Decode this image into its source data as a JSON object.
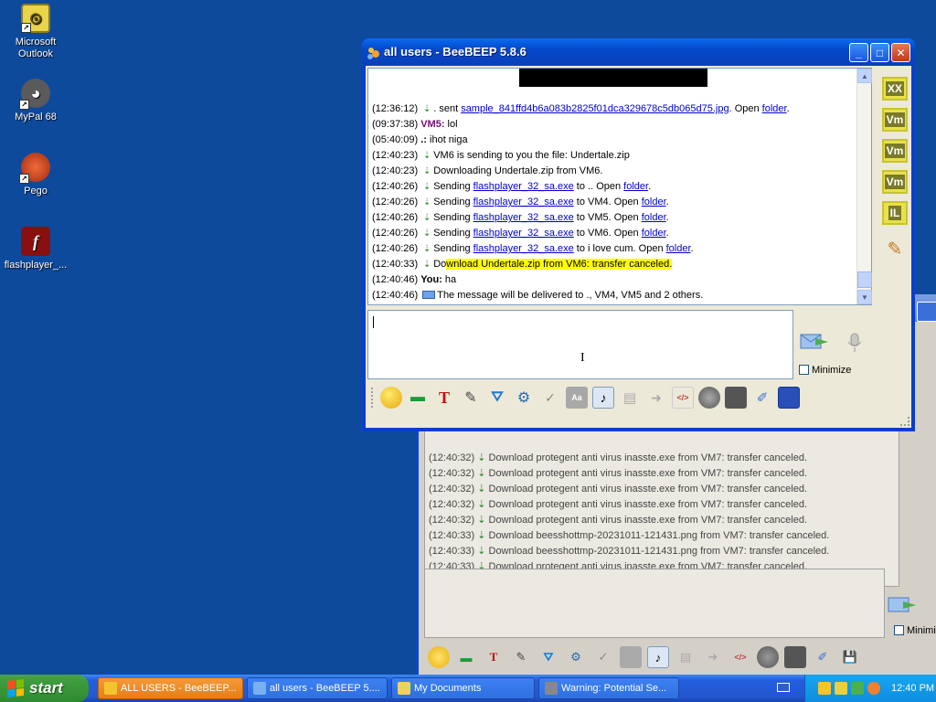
{
  "desktop": {
    "icons": [
      {
        "label": "Microsoft Outlook",
        "icon": "outlook-icon"
      },
      {
        "label": "MyPal 68",
        "icon": "mypal-icon"
      },
      {
        "label": "Pego",
        "icon": "pego-icon"
      },
      {
        "label": "flashplayer_...",
        "icon": "flash-icon"
      }
    ]
  },
  "background_window": {
    "lines": [
      {
        "ts": "(12:40:32)",
        "text": "Download protegent anti virus inasste.exe from VM7: transfer canceled."
      },
      {
        "ts": "(12:40:32)",
        "text": "Download protegent anti virus inasste.exe from VM7: transfer canceled."
      },
      {
        "ts": "(12:40:32)",
        "text": "Download protegent anti virus inasste.exe from VM7: transfer canceled."
      },
      {
        "ts": "(12:40:32)",
        "text": "Download protegent anti virus inasste.exe from VM7: transfer canceled."
      },
      {
        "ts": "(12:40:32)",
        "text": "Download protegent anti virus inasste.exe from VM7: transfer canceled."
      },
      {
        "ts": "(12:40:33)",
        "text": "Download beesshottmp-20231011-121431.png from VM7: transfer canceled."
      },
      {
        "ts": "(12:40:33)",
        "text": "Download beesshottmp-20231011-121431.png from VM7: transfer canceled."
      },
      {
        "ts": "(12:40:33)",
        "text": "Download protegent anti virus inasste.exe from VM7: transfer canceled."
      }
    ],
    "minimize_label": "Minimize"
  },
  "window": {
    "title": "all users - BeeBEEP 5.8.6",
    "minimize_label": "Minimize",
    "messages": {
      "m1": {
        "ts": "(12:36:12)",
        "pre": ". sent ",
        "link": "sample_841ffd4b6a083b2825f01dca329678c5db065d75.jpg",
        "mid": ". Open ",
        "link2": "folder",
        "post": "."
      },
      "m2": {
        "ts": "(09:37:38)",
        "user": "VM5:",
        "text": " lol"
      },
      "m3": {
        "ts": "(05:40:09)",
        "user": ".:",
        "text": " ihot niga"
      },
      "m4": {
        "ts": "(12:40:23)",
        "text": "VM6 is sending to you the file: Undertale.zip"
      },
      "m5": {
        "ts": "(12:40:23)",
        "text": "Downloading Undertale.zip from VM6."
      },
      "m6": {
        "ts": "(12:40:26)",
        "pre": "Sending ",
        "link": "flashplayer_32_sa.exe",
        "mid": " to .. Open ",
        "link2": "folder",
        "post": "."
      },
      "m7": {
        "ts": "(12:40:26)",
        "pre": "Sending ",
        "link": "flashplayer_32_sa.exe",
        "mid": " to VM4. Open ",
        "link2": "folder",
        "post": "."
      },
      "m8": {
        "ts": "(12:40:26)",
        "pre": "Sending ",
        "link": "flashplayer_32_sa.exe",
        "mid": " to VM5. Open ",
        "link2": "folder",
        "post": "."
      },
      "m9": {
        "ts": "(12:40:26)",
        "pre": "Sending ",
        "link": "flashplayer_32_sa.exe",
        "mid": " to VM6. Open ",
        "link2": "folder",
        "post": "."
      },
      "m10": {
        "ts": "(12:40:26)",
        "pre": "Sending ",
        "link": "flashplayer_32_sa.exe",
        "mid": " to i love cum. Open ",
        "link2": "folder",
        "post": "."
      },
      "m11": {
        "ts": "(12:40:33)",
        "pre": "Do",
        "hl": "wnload Undertale.zip from VM6: transfer canceled."
      },
      "m12": {
        "ts": "(12:40:46)",
        "user": "You:",
        "text": " ha"
      },
      "m13": {
        "ts": "(12:40:46)",
        "text": "The message will be delivered to ., VM4, VM5 and 2 others."
      }
    },
    "sidebar": [
      "XX",
      "Vm",
      "Vm",
      "Vm",
      "IL"
    ]
  },
  "taskbar": {
    "start": "start",
    "tasks": [
      {
        "label": "ALL USERS - BeeBEEP...",
        "active": true
      },
      {
        "label": "all users - BeeBEEP 5...."
      },
      {
        "label": "My Documents"
      },
      {
        "label": "Warning: Potential Se..."
      }
    ],
    "clock": "12:40 PM"
  },
  "colors": {
    "accent": "#0a3fcd",
    "highlight": "#ffff00",
    "link": "#0000cc",
    "vm5": "#7a0f7a"
  }
}
